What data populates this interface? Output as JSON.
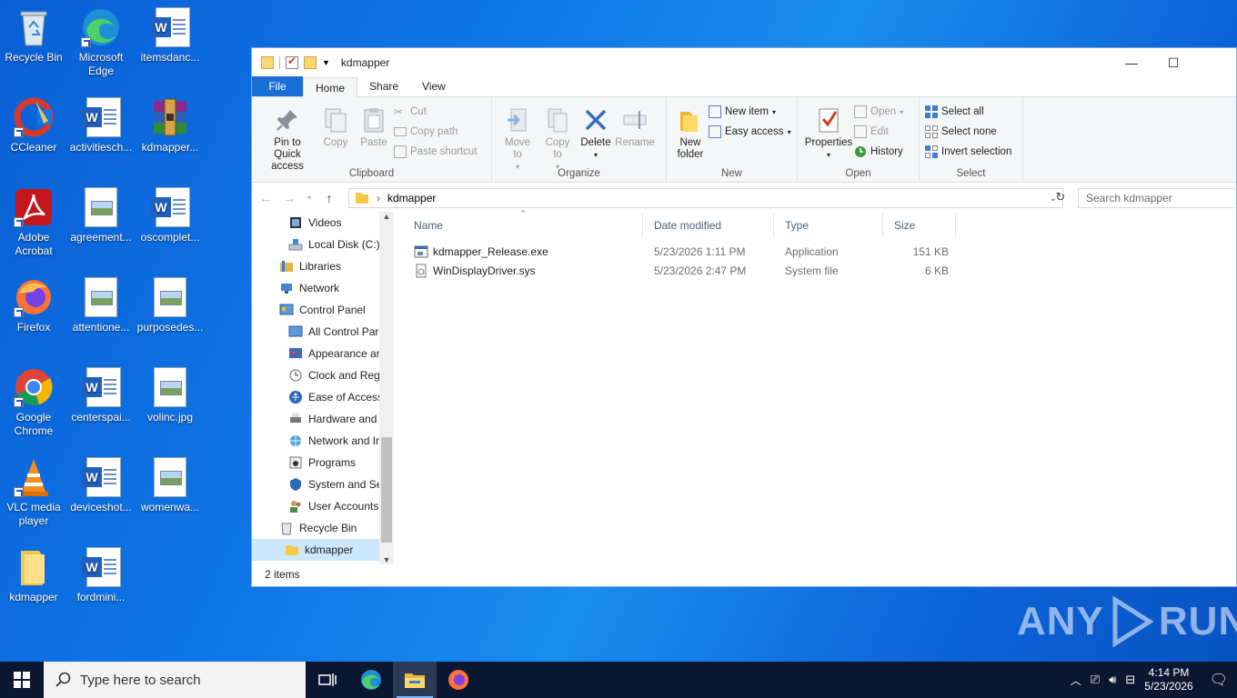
{
  "desktop": {
    "icons": [
      {
        "label": "Recycle Bin"
      },
      {
        "label": "Microsoft Edge"
      },
      {
        "label": "itemsdanc..."
      },
      {
        "label": "CCleaner"
      },
      {
        "label": "activitiesch..."
      },
      {
        "label": "kdmapper..."
      },
      {
        "label": "Adobe Acrobat"
      },
      {
        "label": "agreement..."
      },
      {
        "label": "oscomplet..."
      },
      {
        "label": "Firefox"
      },
      {
        "label": "attentione..."
      },
      {
        "label": "purposedes..."
      },
      {
        "label": "Google Chrome"
      },
      {
        "label": "centerspai..."
      },
      {
        "label": "volinc.jpg"
      },
      {
        "label": "VLC media player"
      },
      {
        "label": "deviceshot..."
      },
      {
        "label": "womenwa..."
      },
      {
        "label": "kdmapper"
      },
      {
        "label": "fordmini..."
      }
    ]
  },
  "window": {
    "title": "kdmapper",
    "tabs": [
      "File",
      "Home",
      "Share",
      "View"
    ],
    "ribbon": {
      "clipboard": {
        "label": "Clipboard",
        "pin": "Pin to Quick access",
        "copy": "Copy",
        "paste": "Paste",
        "cut": "Cut",
        "copy_path": "Copy path",
        "paste_shortcut": "Paste shortcut"
      },
      "organize": {
        "label": "Organize",
        "move_to": "Move to",
        "copy_to": "Copy to",
        "delete": "Delete",
        "rename": "Rename"
      },
      "new": {
        "label": "New",
        "new_folder": "New folder",
        "new_item": "New item",
        "easy_access": "Easy access"
      },
      "open": {
        "label": "Open",
        "properties": "Properties",
        "open": "Open",
        "edit": "Edit",
        "history": "History"
      },
      "select": {
        "label": "Select",
        "select_all": "Select all",
        "select_none": "Select none",
        "invert": "Invert selection"
      }
    },
    "address": {
      "path": "kdmapper",
      "search_placeholder": "Search kdmapper"
    },
    "nav": [
      {
        "label": "Videos",
        "indent": 2
      },
      {
        "label": "Local Disk (C:)",
        "indent": 2
      },
      {
        "label": "Libraries",
        "indent": 1
      },
      {
        "label": "Network",
        "indent": 1
      },
      {
        "label": "Control Panel",
        "indent": 1
      },
      {
        "label": "All Control Par",
        "indent": 2
      },
      {
        "label": "Appearance an",
        "indent": 2
      },
      {
        "label": "Clock and Regi",
        "indent": 2
      },
      {
        "label": "Ease of Access",
        "indent": 2
      },
      {
        "label": "Hardware and",
        "indent": 2
      },
      {
        "label": "Network and Ir",
        "indent": 2
      },
      {
        "label": "Programs",
        "indent": 2
      },
      {
        "label": "System and Sec",
        "indent": 2
      },
      {
        "label": "User Accounts",
        "indent": 2
      },
      {
        "label": "Recycle Bin",
        "indent": 1
      },
      {
        "label": "kdmapper",
        "indent": 1,
        "selected": true
      }
    ],
    "columns": [
      "Name",
      "Date modified",
      "Type",
      "Size"
    ],
    "files": [
      {
        "name": "kdmapper_Release.exe",
        "date": "5/23/2026 1:11 PM",
        "type": "Application",
        "size": "151 KB"
      },
      {
        "name": "WinDisplayDriver.sys",
        "date": "5/23/2026 2:47 PM",
        "type": "System file",
        "size": "6 KB"
      }
    ],
    "status": "2 items"
  },
  "taskbar": {
    "search_placeholder": "Type here to search",
    "time": "4:14 PM",
    "date": "5/23/2026"
  },
  "watermark": {
    "text_left": "ANY",
    "text_right": "RUN"
  }
}
